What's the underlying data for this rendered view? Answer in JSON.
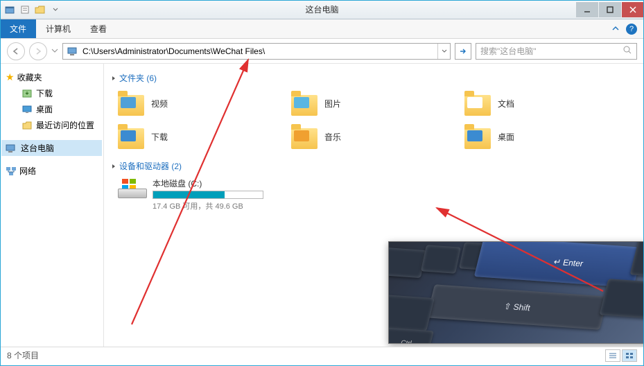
{
  "window": {
    "title": "这台电脑"
  },
  "ribbon": {
    "file": "文件",
    "tabs": [
      "计算机",
      "查看"
    ]
  },
  "address": {
    "path": "C:\\Users\\Administrator\\Documents\\WeChat Files\\"
  },
  "search": {
    "placeholder": "搜索\"这台电脑\""
  },
  "sidebar": {
    "favorites": {
      "label": "收藏夹",
      "items": [
        "下载",
        "桌面",
        "最近访问的位置"
      ]
    },
    "thispc": "这台电脑",
    "network": "网络"
  },
  "sections": {
    "folders": {
      "heading": "文件夹 (6)",
      "items": [
        {
          "label": "视频",
          "tint": "#4fa0d8"
        },
        {
          "label": "图片",
          "tint": "#59b6e2"
        },
        {
          "label": "文档",
          "tint": "#ffffff"
        },
        {
          "label": "下载",
          "tint": "#3b8bd1"
        },
        {
          "label": "音乐",
          "tint": "#f0a030"
        },
        {
          "label": "桌面",
          "tint": "#3b8bd1"
        }
      ]
    },
    "drives": {
      "heading": "设备和驱动器 (2)",
      "items": [
        {
          "label": "本地磁盘 (C:)",
          "used_pct": 65,
          "free": "17.4 GB 可用，共 49.6 GB"
        }
      ]
    }
  },
  "keyboard": {
    "enter": "Enter",
    "shift": "Shift"
  },
  "status": {
    "count": "8 个项目"
  }
}
